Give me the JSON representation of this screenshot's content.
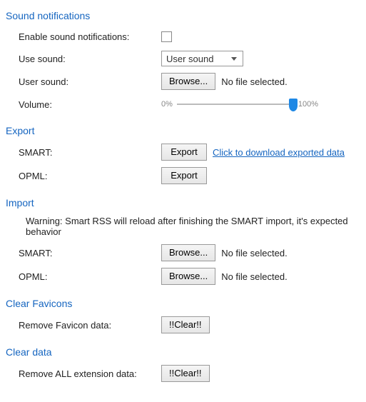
{
  "sound": {
    "title": "Sound notifications",
    "enable_label": "Enable sound notifications:",
    "use_sound_label": "Use sound:",
    "use_sound_value": "User sound",
    "user_sound_label": "User sound:",
    "browse_btn": "Browse...",
    "no_file": "No file selected.",
    "volume_label": "Volume:",
    "vol_min": "0%",
    "vol_max": "100%"
  },
  "export": {
    "title": "Export",
    "smart_label": "SMART:",
    "opml_label": "OPML:",
    "export_btn": "Export",
    "download_link": "Click to download exported data"
  },
  "import": {
    "title": "Import",
    "warning": "Warning: Smart RSS will reload after finishing the SMART import, it's expected behavior",
    "smart_label": "SMART:",
    "opml_label": "OPML:",
    "browse_btn": "Browse...",
    "no_file": "No file selected."
  },
  "favicons": {
    "title": "Clear Favicons",
    "remove_label": "Remove Favicon data:",
    "clear_btn": "!!Clear!!"
  },
  "cleardata": {
    "title": "Clear data",
    "remove_label": "Remove ALL extension data:",
    "clear_btn": "!!Clear!!"
  }
}
